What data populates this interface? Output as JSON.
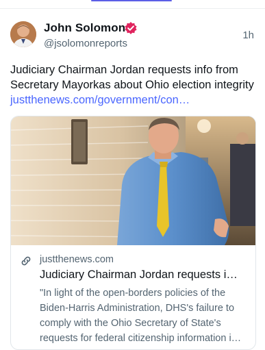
{
  "post": {
    "author_name": "John Solomon",
    "handle": "@jsolomonreports",
    "time": "1h",
    "text": "Judiciary Chairman Jordan requests info from Secretary Mayorkas about Ohio election integrity ",
    "link_text": "justthenews.com/government/con…",
    "verified_color": "#e0245e"
  },
  "card": {
    "domain": "justthenews.com",
    "title": "Judiciary Chairman Jordan requests i…",
    "description": "\"In light of the open-borders policies of the Biden-Harris Administration, DHS's failure to comply with the Ohio Secretary of State's requests for federal citizenship information i…"
  }
}
